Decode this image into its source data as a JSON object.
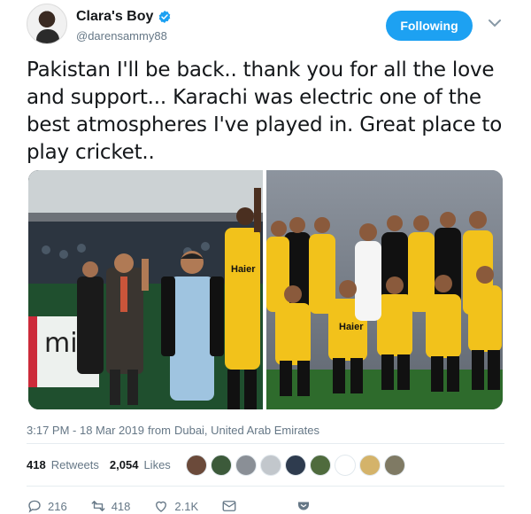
{
  "tweet": {
    "display_name": "Clara's Boy",
    "handle": "@darensammy88",
    "follow_label": "Following",
    "text": "Pakistan I'll be back.. thank you for all the love and  support... Karachi was electric one of the best atmospheres I've played in. Great place to play cricket..",
    "time": "3:17 PM - 18 Mar 2019",
    "from_label": "from",
    "location": "Dubai, United Arab Emirates"
  },
  "stats": {
    "retweets_count": "418",
    "retweets_label": "Retweets",
    "likes_count": "2,054",
    "likes_label": "Likes"
  },
  "actions": {
    "replies": "216",
    "retweets": "418",
    "likes": "2.1K"
  },
  "media": {
    "left_board_text": "mir",
    "left_jersey_text": "Haier",
    "right_jersey_text": "Haier"
  },
  "colors": {
    "accent": "#1da1f2",
    "jersey_yellow": "#f2c21b",
    "text_secondary": "#657786"
  },
  "icons": [
    "verified-icon",
    "caret-down-icon",
    "reply-icon",
    "retweet-icon",
    "like-icon",
    "dm-icon",
    "bookmark-icon"
  ]
}
